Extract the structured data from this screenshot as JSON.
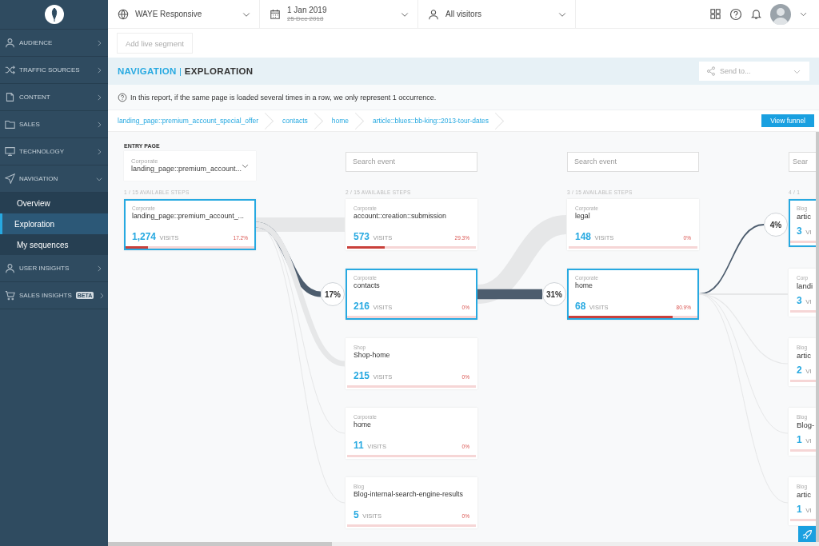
{
  "sidebar": {
    "items": [
      {
        "label": "AUDIENCE",
        "expanded": false
      },
      {
        "label": "TRAFFIC SOURCES",
        "expanded": false
      },
      {
        "label": "CONTENT",
        "expanded": false
      },
      {
        "label": "SALES",
        "expanded": false
      },
      {
        "label": "TECHNOLOGY",
        "expanded": false
      },
      {
        "label": "NAVIGATION",
        "expanded": true,
        "children": [
          {
            "label": "Overview",
            "selected": false
          },
          {
            "label": "Exploration",
            "selected": true
          },
          {
            "label": "My sequences",
            "selected": false
          }
        ]
      },
      {
        "label": "USER INSIGHTS",
        "expanded": false
      },
      {
        "label": "SALES INSIGHTS",
        "badge": "BETA",
        "expanded": false
      }
    ]
  },
  "topbar": {
    "site": "WAYE Responsive",
    "date": "1 Jan 2019",
    "compare_date": "25 Dec 2018",
    "audience": "All visitors"
  },
  "segment_button": "Add live segment",
  "header": {
    "section": "NAVIGATION",
    "separator": "|",
    "page": "EXPLORATION",
    "send_to": {
      "placeholder": "Send to..."
    }
  },
  "info": "In this report, if the same page is loaded several times in a row, we only represent 1 occurrence.",
  "breadcrumb": [
    "landing_page::premium_account_special_offer",
    "contacts",
    "home",
    "article::blues::bb-king::2013-tour-dates"
  ],
  "view_funnel": "View funnel",
  "columns": [
    {
      "kind": "entry",
      "title": "ENTRY PAGE",
      "picker": {
        "category": "Corporate",
        "value": "landing_page::premium_account..."
      },
      "steps_label": "1 / 15 AVAILABLE STEPS",
      "cards": [
        {
          "category": "Corporate",
          "name": "landing_page::premium_account_...",
          "visits": "1,274",
          "unit": "VISITS",
          "percent": "17.2%",
          "level": 0.172,
          "selected": true
        }
      ]
    },
    {
      "kind": "step",
      "search": {
        "placeholder": "Search event"
      },
      "steps_label": "2 / 15 AVAILABLE STEPS",
      "cards": [
        {
          "category": "Corporate",
          "name": "account::creation::submission",
          "visits": "573",
          "unit": "VISITS",
          "percent": "29.3%",
          "level": 0.293,
          "selected": false
        },
        {
          "category": "Corporate",
          "name": "contacts",
          "visits": "216",
          "unit": "VISITS",
          "percent": "0%",
          "selected": true,
          "share": "17%"
        },
        {
          "category": "Shop",
          "name": "Shop-home",
          "visits": "215",
          "unit": "VISITS",
          "percent": "0%",
          "selected": false
        },
        {
          "category": "Corporate",
          "name": "home",
          "visits": "11",
          "unit": "VISITS",
          "percent": "0%",
          "selected": false
        },
        {
          "category": "Blog",
          "name": "Blog-internal-search-engine-results",
          "visits": "5",
          "unit": "VISITS",
          "percent": "0%",
          "selected": false
        }
      ]
    },
    {
      "kind": "step",
      "search": {
        "placeholder": "Search event"
      },
      "steps_label": "3 / 15 AVAILABLE STEPS",
      "cards": [
        {
          "category": "Corporate",
          "name": "legal",
          "visits": "148",
          "unit": "VISITS",
          "percent": "0%",
          "selected": false
        },
        {
          "category": "Corporate",
          "name": "home",
          "visits": "68",
          "unit": "VISITS",
          "percent": "80.9%",
          "level": 0.809,
          "selected": true,
          "share": "31%"
        }
      ]
    },
    {
      "kind": "partial",
      "search": {
        "placeholder": "Sear"
      },
      "steps_label": "4 / 1",
      "cards": [
        {
          "category": "Blog",
          "name": "artic",
          "visits": "3",
          "unit": "VI",
          "selected": true,
          "share": "4%"
        },
        {
          "category": "Corp",
          "name": "landi",
          "visits": "3",
          "unit": "VI",
          "selected": false
        },
        {
          "category": "Blog",
          "name": "artic",
          "visits": "2",
          "unit": "VI",
          "selected": false
        },
        {
          "category": "Blog",
          "name": "Blog-",
          "visits": "1",
          "unit": "VI",
          "selected": false
        },
        {
          "category": "Blog",
          "name": "artic",
          "visits": "1",
          "unit": "VI",
          "selected": false
        }
      ]
    }
  ]
}
